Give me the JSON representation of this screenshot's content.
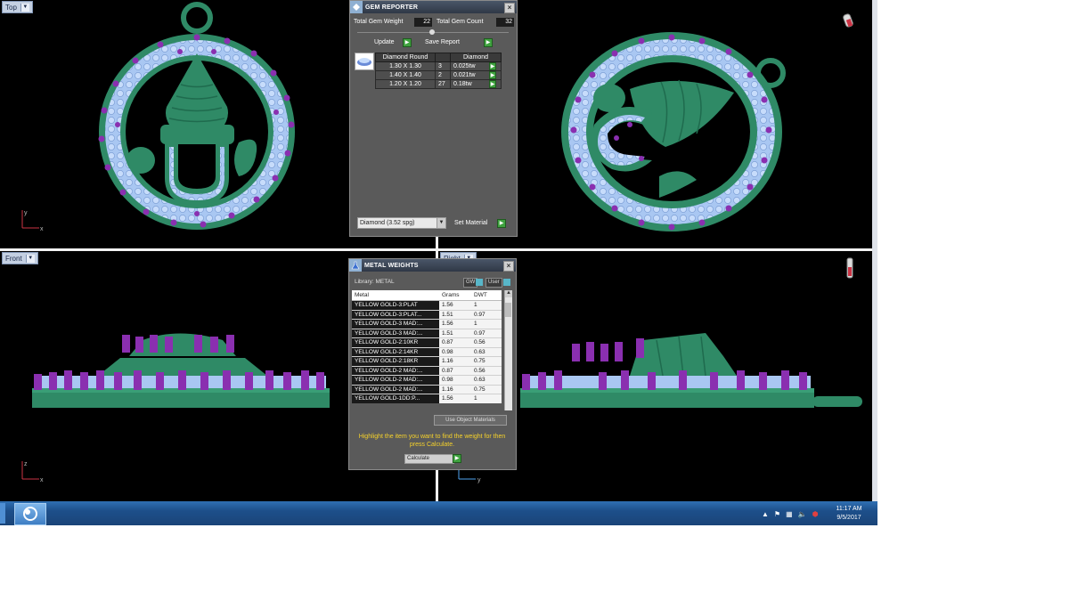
{
  "viewports": {
    "top_left": {
      "label": "Top"
    },
    "top_right": {
      "label": ""
    },
    "bottom_left": {
      "label": "Front"
    },
    "bottom_right": {
      "label": "Right"
    }
  },
  "axes": {
    "tl": {
      "v": "y",
      "h": "x"
    },
    "tr": {
      "v": "",
      "h": "x"
    },
    "bl": {
      "v": "z",
      "h": "x"
    },
    "br": {
      "v": "",
      "h": "y"
    }
  },
  "gem_reporter": {
    "title": "GEM REPORTER",
    "total_weight_label": "Total Gem Weight",
    "total_weight_value": "22",
    "total_count_label": "Total Gem Count",
    "total_count_value": "32",
    "update_label": "Update",
    "save_report_label": "Save Report",
    "columns": [
      "Diamond Round",
      "",
      "Diamond"
    ],
    "rows": [
      {
        "size": "1.30 X 1.30",
        "count": "3",
        "ctw": "0.025tw"
      },
      {
        "size": "1.40 X 1.40",
        "count": "2",
        "ctw": "0.021tw"
      },
      {
        "size": "1.20 X 1.20",
        "count": "27",
        "ctw": "0.18tw"
      }
    ],
    "material_select": "Diamond    (3.52 spg)",
    "set_material_label": "Set Material"
  },
  "metal_weights": {
    "title": "METAL WEIGHTS",
    "library_label": "Library: METAL",
    "gw_label": "GW",
    "user_label": "User",
    "columns": {
      "metal": "Metal",
      "grams": "Grams",
      "dwt": "DWT"
    },
    "rows": [
      {
        "metal": "YELLOW GOLD-3:PLAT",
        "grams": "1.56",
        "dwt": "1"
      },
      {
        "metal": "YELLOW GOLD-3:PLAT...",
        "grams": "1.51",
        "dwt": "0.97"
      },
      {
        "metal": "YELLOW GOLD-3 MAD:...",
        "grams": "1.56",
        "dwt": "1"
      },
      {
        "metal": "YELLOW GOLD-3 MAD:...",
        "grams": "1.51",
        "dwt": "0.97"
      },
      {
        "metal": "YELLOW GOLD-2:10KR",
        "grams": "0.87",
        "dwt": "0.56"
      },
      {
        "metal": "YELLOW GOLD-2:14KR",
        "grams": "0.98",
        "dwt": "0.63"
      },
      {
        "metal": "YELLOW GOLD-2:18KR",
        "grams": "1.16",
        "dwt": "0.75"
      },
      {
        "metal": "YELLOW GOLD-2 MAD:...",
        "grams": "0.87",
        "dwt": "0.56"
      },
      {
        "metal": "YELLOW GOLD-2 MAD:...",
        "grams": "0.98",
        "dwt": "0.63"
      },
      {
        "metal": "YELLOW GOLD-2 MAD:...",
        "grams": "1.16",
        "dwt": "0.75"
      },
      {
        "metal": "YELLOW GOLD-1DD:P...",
        "grams": "1.56",
        "dwt": "1"
      }
    ],
    "use_object_materials_label": "Use Object Materials",
    "hint": "Highlight the item you want to find the weight for then press Calculate.",
    "calculate_label": "Calculate"
  },
  "taskbar": {
    "time": "11:17 AM",
    "date": "9/5/2017"
  },
  "colors": {
    "metal_green": "#2f8a66",
    "gem_light": "#a9c7f2",
    "prong_purple": "#8a2fb0",
    "hint_yellow": "#f5d12b"
  }
}
